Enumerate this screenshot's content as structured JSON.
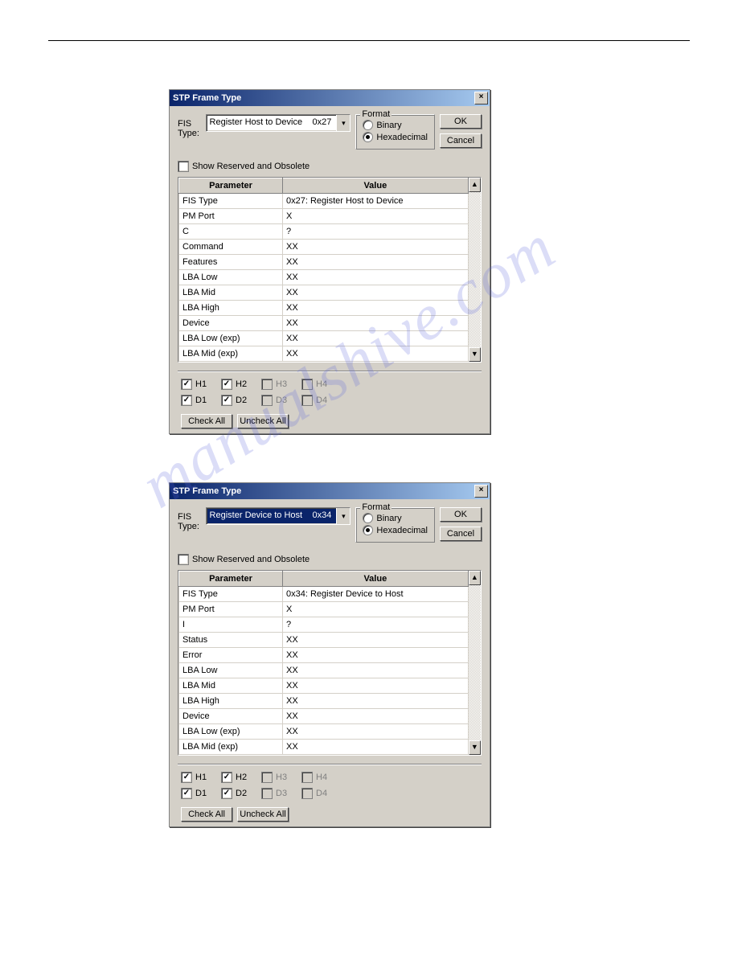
{
  "watermark": "manualshive.com",
  "dialogs": [
    {
      "title": "STP Frame Type",
      "fis_label": "FIS Type:",
      "fis_value_text": "Register Host to Device",
      "fis_value_code": "0x27",
      "fis_selected_highlight": false,
      "format_legend": "Format",
      "format_binary": "Binary",
      "format_hex": "Hexadecimal",
      "ok": "OK",
      "cancel": "Cancel",
      "show_reserved": "Show Reserved and Obsolete",
      "col_param": "Parameter",
      "col_value": "Value",
      "rows": [
        {
          "p": "FIS Type",
          "v": "0x27: Register Host to Device"
        },
        {
          "p": "PM Port",
          "v": "X"
        },
        {
          "p": "C",
          "v": "?"
        },
        {
          "p": "Command",
          "v": "XX"
        },
        {
          "p": "Features",
          "v": "XX"
        },
        {
          "p": "LBA Low",
          "v": "XX"
        },
        {
          "p": "LBA Mid",
          "v": "XX"
        },
        {
          "p": "LBA High",
          "v": "XX"
        },
        {
          "p": "Device",
          "v": "XX"
        },
        {
          "p": "LBA Low (exp)",
          "v": "XX"
        },
        {
          "p": "LBA Mid (exp)",
          "v": "XX"
        }
      ],
      "chks": [
        {
          "l": "H1",
          "c": true,
          "d": false
        },
        {
          "l": "H2",
          "c": true,
          "d": false
        },
        {
          "l": "H3",
          "c": false,
          "d": true
        },
        {
          "l": "H4",
          "c": false,
          "d": true
        },
        {
          "l": "D1",
          "c": true,
          "d": false
        },
        {
          "l": "D2",
          "c": true,
          "d": false
        },
        {
          "l": "D3",
          "c": false,
          "d": true
        },
        {
          "l": "D4",
          "c": false,
          "d": true
        }
      ],
      "check_all": "Check All",
      "uncheck_all": "Uncheck All"
    },
    {
      "title": "STP Frame Type",
      "fis_label": "FIS Type:",
      "fis_value_text": "Register Device to Host",
      "fis_value_code": "0x34",
      "fis_selected_highlight": true,
      "format_legend": "Format",
      "format_binary": "Binary",
      "format_hex": "Hexadecimal",
      "ok": "OK",
      "cancel": "Cancel",
      "show_reserved": "Show Reserved and Obsolete",
      "col_param": "Parameter",
      "col_value": "Value",
      "rows": [
        {
          "p": "FIS Type",
          "v": "0x34: Register Device to Host"
        },
        {
          "p": "PM Port",
          "v": "X"
        },
        {
          "p": "I",
          "v": "?"
        },
        {
          "p": "Status",
          "v": "XX"
        },
        {
          "p": "Error",
          "v": "XX"
        },
        {
          "p": "LBA Low",
          "v": "XX"
        },
        {
          "p": "LBA Mid",
          "v": "XX"
        },
        {
          "p": "LBA High",
          "v": "XX"
        },
        {
          "p": "Device",
          "v": "XX"
        },
        {
          "p": "LBA Low (exp)",
          "v": "XX"
        },
        {
          "p": "LBA Mid (exp)",
          "v": "XX"
        }
      ],
      "chks": [
        {
          "l": "H1",
          "c": true,
          "d": false
        },
        {
          "l": "H2",
          "c": true,
          "d": false
        },
        {
          "l": "H3",
          "c": false,
          "d": true
        },
        {
          "l": "H4",
          "c": false,
          "d": true
        },
        {
          "l": "D1",
          "c": true,
          "d": false
        },
        {
          "l": "D2",
          "c": true,
          "d": false
        },
        {
          "l": "D3",
          "c": false,
          "d": true
        },
        {
          "l": "D4",
          "c": false,
          "d": true
        }
      ],
      "check_all": "Check All",
      "uncheck_all": "Uncheck All"
    }
  ]
}
